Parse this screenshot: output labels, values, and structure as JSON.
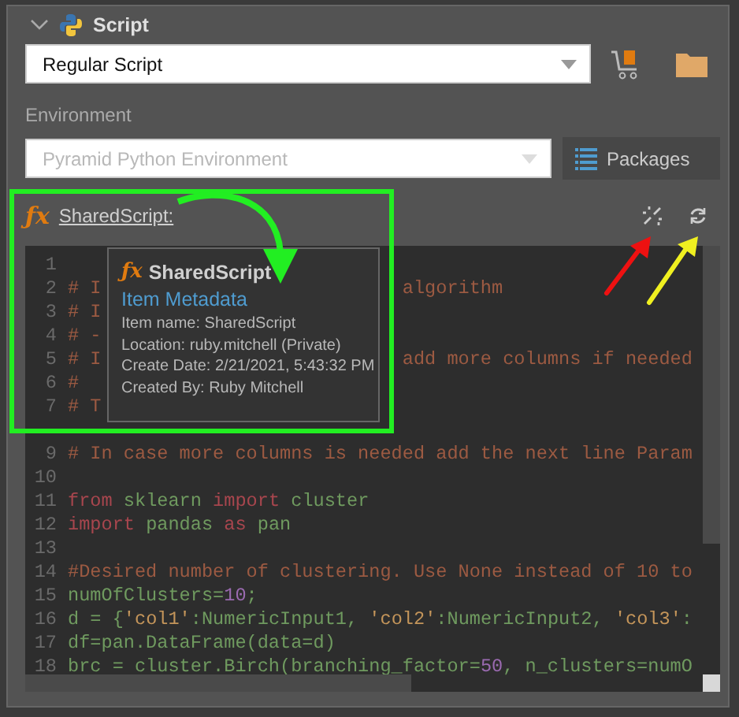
{
  "section": {
    "title": "Script",
    "expanded": true
  },
  "script_type": {
    "value": "Regular Script"
  },
  "environment": {
    "label": "Environment",
    "value": "Pyramid Python Environment",
    "disabled": true
  },
  "packages_button": {
    "label": "Packages"
  },
  "shared_script": {
    "icon": "ƒx",
    "link": "SharedScript:"
  },
  "tooltip": {
    "icon": "ƒx",
    "title": "SharedScript",
    "heading": "Item Metadata",
    "lines": [
      "Item name: SharedScript",
      "Location: ruby.mitchell (Private)",
      "Create Date: 2/21/2021, 5:43:32 PM",
      "Created By: Ruby Mitchell"
    ]
  },
  "code_lines": [
    {
      "num": "1"
    },
    {
      "num": "2",
      "tokens": [
        {
          "kind": "comment",
          "text": "# I"
        }
      ],
      "right": [
        {
          "kind": "comment",
          "text": "algorithm"
        }
      ]
    },
    {
      "num": "3",
      "tokens": [
        {
          "kind": "comment",
          "text": "# I"
        }
      ]
    },
    {
      "num": "4",
      "tokens": [
        {
          "kind": "comment",
          "text": "# -"
        }
      ]
    },
    {
      "num": "5",
      "tokens": [
        {
          "kind": "comment",
          "text": "# I"
        }
      ],
      "right": [
        {
          "kind": "comment",
          "text": "add more columns if needed"
        }
      ]
    },
    {
      "num": "6",
      "tokens": [
        {
          "kind": "comment",
          "text": "#"
        }
      ]
    },
    {
      "num": "7",
      "tokens": [
        {
          "kind": "comment",
          "text": "# T"
        }
      ]
    },
    {
      "num": "9",
      "gap_before": true,
      "tokens": [
        {
          "kind": "comment",
          "text": "# In case more columns is needed add the next line Param"
        }
      ]
    },
    {
      "num": "10"
    },
    {
      "num": "11",
      "tokens": [
        {
          "kind": "keyword",
          "text": "from"
        },
        {
          "kind": "name",
          "text": " sklearn "
        },
        {
          "kind": "keyword",
          "text": "import"
        },
        {
          "kind": "name",
          "text": " cluster"
        }
      ]
    },
    {
      "num": "12",
      "tokens": [
        {
          "kind": "keyword",
          "text": "import"
        },
        {
          "kind": "name",
          "text": " pandas "
        },
        {
          "kind": "keyword",
          "text": "as"
        },
        {
          "kind": "name",
          "text": " pan"
        }
      ]
    },
    {
      "num": "13"
    },
    {
      "num": "14",
      "tokens": [
        {
          "kind": "comment",
          "text": "#Desired number of clustering. Use None instead of 10 to"
        }
      ]
    },
    {
      "num": "15",
      "tokens": [
        {
          "kind": "name",
          "text": "numOfClusters="
        },
        {
          "kind": "number",
          "text": "10"
        },
        {
          "kind": "name",
          "text": ";"
        }
      ]
    },
    {
      "num": "16",
      "tokens": [
        {
          "kind": "name",
          "text": "d = {"
        },
        {
          "kind": "string",
          "text": "'col1'"
        },
        {
          "kind": "name",
          "text": ":NumericInput1, "
        },
        {
          "kind": "string",
          "text": "'col2'"
        },
        {
          "kind": "name",
          "text": ":NumericInput2, "
        },
        {
          "kind": "string",
          "text": "'col3'"
        },
        {
          "kind": "name",
          "text": ":"
        }
      ]
    },
    {
      "num": "17",
      "tokens": [
        {
          "kind": "name",
          "text": "df=pan.DataFrame(data=d)"
        }
      ]
    },
    {
      "num": "18",
      "tokens": [
        {
          "kind": "name",
          "text": "brc = cluster.Birch(branching_factor="
        },
        {
          "kind": "number",
          "text": "50"
        },
        {
          "kind": "name",
          "text": ", n_clusters=numO"
        }
      ]
    }
  ]
}
